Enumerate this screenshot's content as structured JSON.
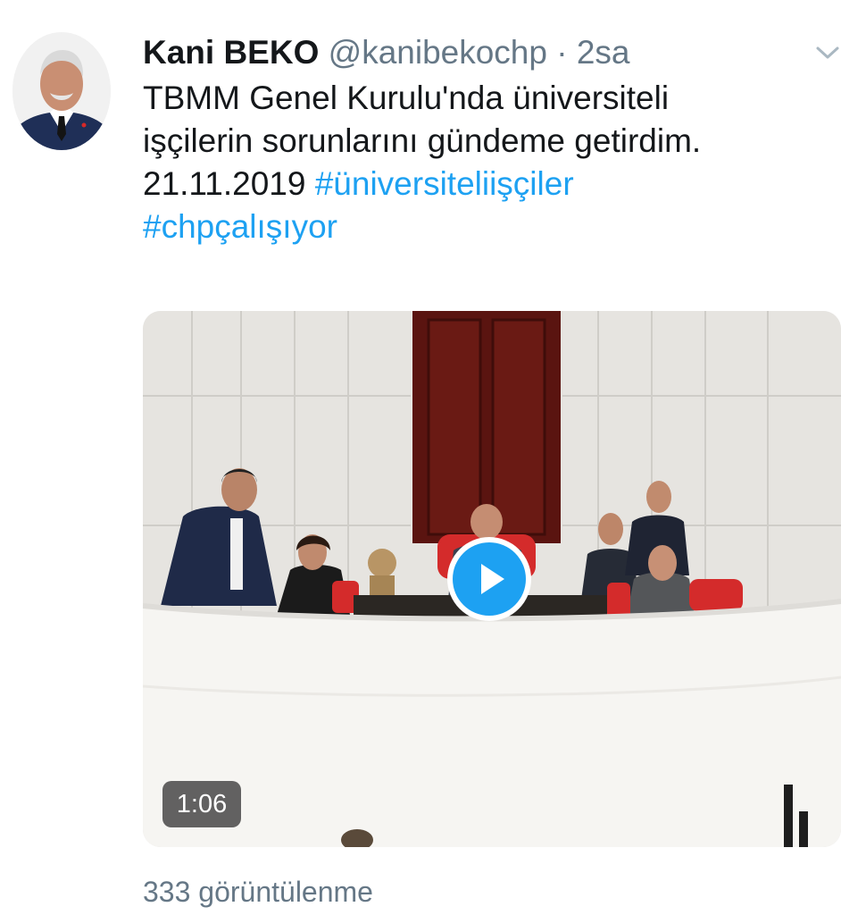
{
  "tweet": {
    "display_name": "Kani BEKO",
    "handle": "@kanibekochp",
    "separator": "·",
    "time": "2sa",
    "text_line1": "TBMM Genel Kurulu'nda üniversiteli",
    "text_line2": "işçilerin sorunlarını gündeme getirdim.",
    "text_date": "21.11.2019",
    "hashtags": [
      "#üniversiteliişçiler",
      "#chpçalışıyor"
    ],
    "icons": {
      "avatar": "avatar-portrait",
      "menu": "chevron-down-icon",
      "play": "play-icon"
    }
  },
  "video": {
    "duration": "1:06"
  },
  "stats": {
    "views": "333 görüntülenme"
  },
  "colors": {
    "link": "#1da1f2",
    "secondary_text": "#657786",
    "play_button": "#1da1f2"
  }
}
